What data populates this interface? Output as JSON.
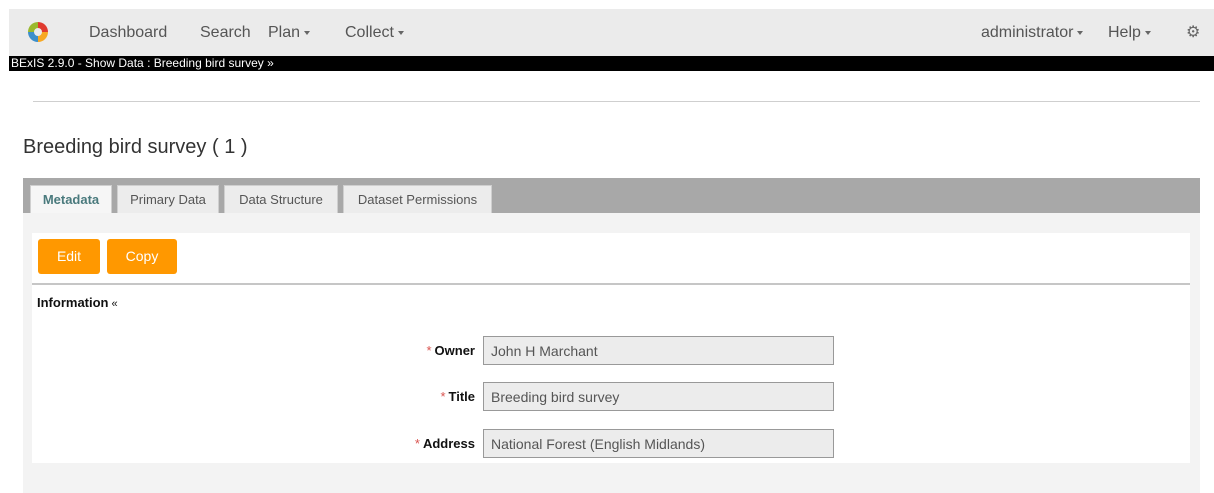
{
  "nav": {
    "items": [
      {
        "label": "Dashboard"
      },
      {
        "label": "Search"
      },
      {
        "label": "Plan"
      },
      {
        "label": "Collect"
      }
    ],
    "right": [
      {
        "label": "administrator"
      },
      {
        "label": "Help"
      }
    ]
  },
  "blackbar": {
    "text": "BExIS 2.9.0 - Show Data : Breeding bird survey »"
  },
  "page": {
    "title": "Breeding bird survey ( 1 )"
  },
  "tabs": [
    {
      "label": "Metadata",
      "active": true
    },
    {
      "label": "Primary Data"
    },
    {
      "label": "Data Structure"
    },
    {
      "label": "Dataset Permissions"
    }
  ],
  "actions": {
    "edit": "Edit",
    "copy": "Copy"
  },
  "section": {
    "title": "Information",
    "chevron": "«"
  },
  "fields": [
    {
      "label": "Owner",
      "required": "*",
      "value": "John H Marchant"
    },
    {
      "label": "Title",
      "required": "*",
      "value": "Breeding bird survey"
    },
    {
      "label": "Address",
      "required": "*",
      "value": "National Forest (English Midlands)"
    }
  ],
  "colors": {
    "accent": "#ff9800",
    "tab_active_text": "#4a7a7d",
    "required": "#d9534f"
  }
}
